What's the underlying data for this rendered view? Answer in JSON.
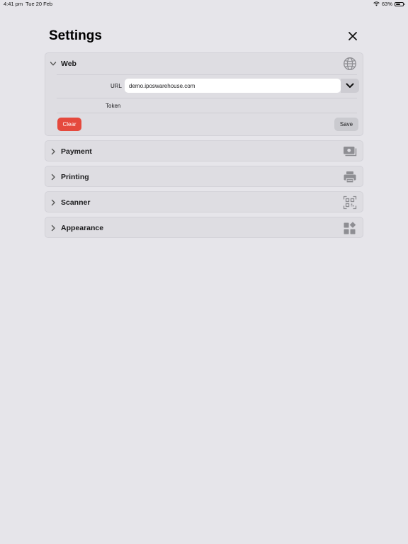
{
  "status_bar": {
    "time": "4:41 pm",
    "date": "Tue 20 Feb",
    "battery": "63%",
    "battery_level": 0.63
  },
  "page": {
    "title": "Settings",
    "close_icon": "close-icon"
  },
  "sections": {
    "web": {
      "title": "Web",
      "icon": "globe-icon",
      "expanded": true,
      "url_label": "URL",
      "url_value": "demo.iposwarehouse.com",
      "token_label": "Token",
      "token_value": "",
      "clear_label": "Clear",
      "save_label": "Save"
    },
    "payment": {
      "title": "Payment",
      "icon": "cash-icon",
      "expanded": false
    },
    "printing": {
      "title": "Printing",
      "icon": "printer-icon",
      "expanded": false
    },
    "scanner": {
      "title": "Scanner",
      "icon": "qr-scan-icon",
      "expanded": false
    },
    "appearance": {
      "title": "Appearance",
      "icon": "widgets-icon",
      "expanded": false
    }
  },
  "colors": {
    "background": "#e6e5ea",
    "panel": "#dedde2",
    "clear_button": "#e5493d",
    "save_button": "#cacacf",
    "icon_gray": "#8e8e93"
  }
}
